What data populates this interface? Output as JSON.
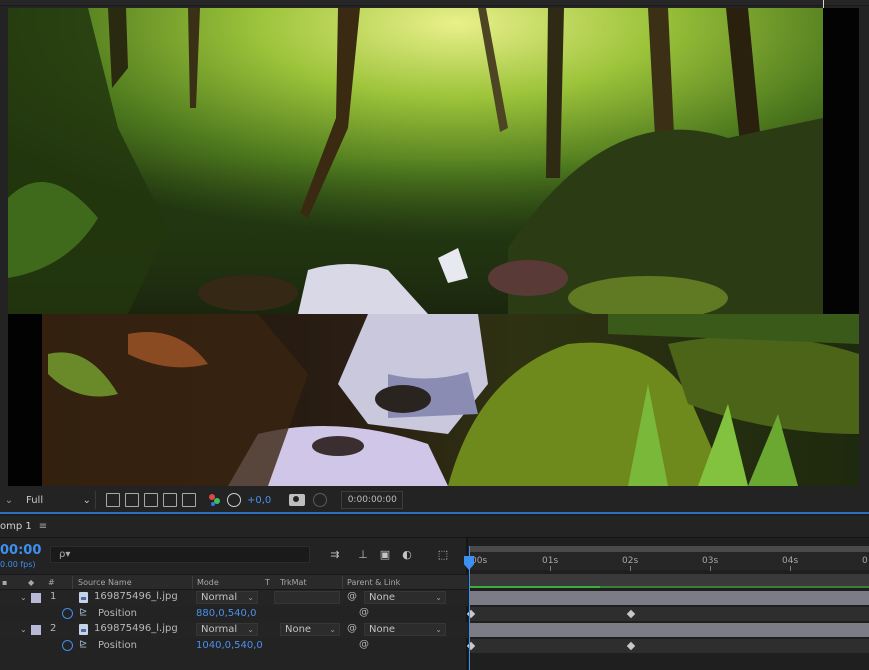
{
  "viewer": {
    "resolution": "Full",
    "exposure": "+0,0",
    "timecode": "0:00:00:00"
  },
  "timeline": {
    "comp_tab": "omp 1",
    "menu_glyph": "≡",
    "current_time": "00:00",
    "fps": "0.00 fps)",
    "search_placeholder": "ρ▾",
    "columns": {
      "hash": "#",
      "source_name": "Source Name",
      "mode": "Mode",
      "t": "T",
      "trkmat": "TrkMat",
      "parent_link": "Parent & Link"
    },
    "ruler_labels": [
      "00s",
      "01s",
      "02s",
      "03s",
      "04s",
      "0"
    ],
    "layers": [
      {
        "index": "1",
        "name": "169875496_l.jpg",
        "mode": "Normal",
        "trkmat": "",
        "parent": "None",
        "color": "#b8b8d8",
        "property": "Position",
        "value": "880,0,540,0"
      },
      {
        "index": "2",
        "name": "169875496_l.jpg",
        "mode": "Normal",
        "trkmat": "None",
        "parent": "None",
        "color": "#b8b8d8",
        "property": "Position",
        "value": "1040,0,540,0"
      }
    ]
  },
  "icons": {
    "toolbar": [
      "chevron-down-icon",
      "region-of-interest-icon",
      "transparency-grid-icon",
      "mask-toggle-icon",
      "safe-area-icon",
      "3d-view-icon",
      "channel-rgb-icon",
      "reset-exposure-icon",
      "camera-icon",
      "color-view-icon"
    ],
    "timeline": [
      "draft-3d-icon",
      "comp-flowchart-icon",
      "shy-icon",
      "frame-blend-icon",
      "motion-blur-icon",
      "graph-editor-icon"
    ]
  },
  "colors": {
    "accent": "#3d8ff0",
    "panel": "#232323",
    "cache_bar": "#3cae3c",
    "layer_bar": "#7c7c86"
  }
}
